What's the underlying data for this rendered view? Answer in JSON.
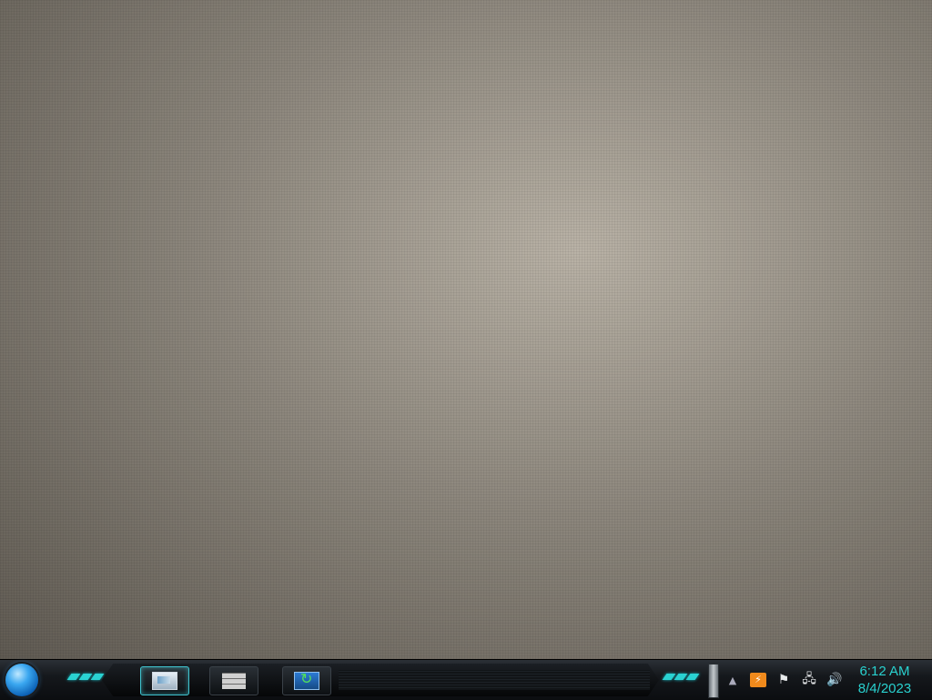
{
  "taskbar": {
    "start_icon": "start-orb",
    "tasks": [
      {
        "name": "monitor-icon",
        "active": true
      },
      {
        "name": "brick-wall-icon",
        "active": false
      },
      {
        "name": "refresh-icon",
        "active": false
      }
    ],
    "tray": {
      "icons": [
        "chevron-up-icon",
        "app-icon",
        "flag-icon",
        "network-icon",
        "speaker-icon"
      ],
      "up_glyph": "▲",
      "app_glyph": "⚡",
      "flag_glyph": "⚑",
      "network_glyph": "🖧",
      "speaker_glyph": "🔊"
    },
    "clock": {
      "time": "6:12 AM",
      "date": "8/4/2023"
    }
  },
  "colors": {
    "accent": "#29d1cf",
    "start_orb": "#3aa7f0"
  }
}
